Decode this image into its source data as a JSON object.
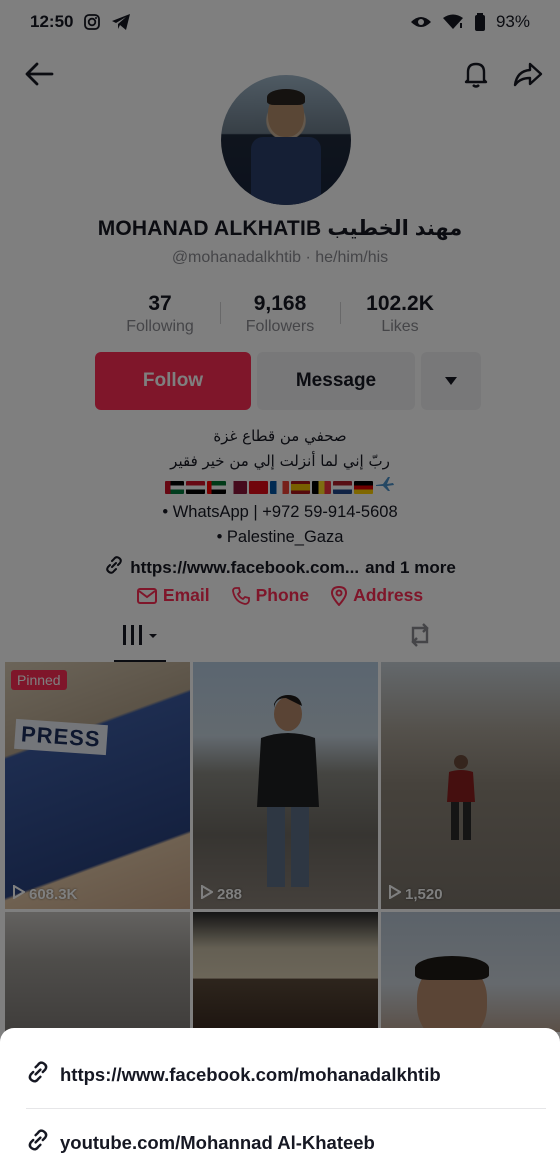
{
  "status_bar": {
    "time": "12:50",
    "battery": "93%",
    "icons": [
      "instagram-icon",
      "telegram-icon",
      "eye-icon",
      "wifi-icon",
      "battery-icon"
    ]
  },
  "profile": {
    "display_name": "MOHANAD ALKHATIB مهند الخطيب",
    "handle": "@mohanadalkhtib · he/him/his",
    "stats": [
      {
        "value": "37",
        "label": "Following"
      },
      {
        "value": "9,168",
        "label": "Followers"
      },
      {
        "value": "102.2K",
        "label": "Likes"
      }
    ],
    "buttons": {
      "follow": "Follow",
      "message": "Message"
    },
    "bio": {
      "line1": "صحفي من قطاع غزة",
      "line2": "ربّ إني لما أنزلت إلي من خير فقير",
      "line3": "• WhatsApp | +972 59-914-5608",
      "line4": "• Palestine_Gaza"
    },
    "link": {
      "text": "https://www.facebook.com...",
      "more": "and 1 more"
    },
    "contacts": {
      "email": "Email",
      "phone": "Phone",
      "address": "Address"
    }
  },
  "flags": [
    "#007a3d",
    "#ce1126",
    "#00732f",
    "#8a1538",
    "#e30a17",
    "#0055a4",
    "#aa151b",
    "#000000",
    "#21468b",
    "#ffce00"
  ],
  "videos": [
    {
      "pinned": "Pinned",
      "views": "608.3K"
    },
    {
      "views": "288"
    },
    {
      "views": "1,520"
    }
  ],
  "sheet": {
    "links": [
      "https://www.facebook.com/mohanadalkhtib",
      "youtube.com/Mohannad Al-Khateeb"
    ]
  },
  "colors": {
    "accent": "#fe2c55",
    "text": "#161823",
    "muted": "#8a8b91"
  }
}
